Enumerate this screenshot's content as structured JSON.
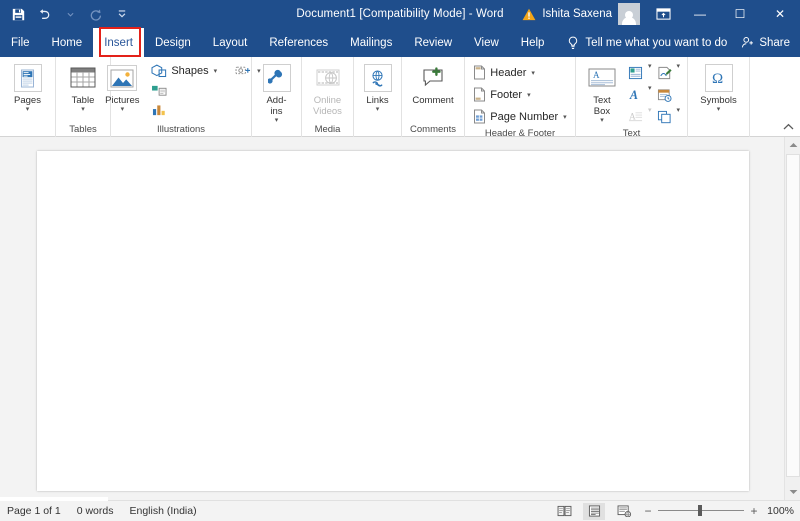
{
  "window": {
    "title": "Document1 [Compatibility Mode]  -  Word",
    "quick_access": [
      {
        "name": "save",
        "icon": "save-icon"
      },
      {
        "name": "undo",
        "icon": "undo-icon"
      },
      {
        "name": "redo",
        "icon": "redo-icon"
      },
      {
        "name": "customize-quick-access-toolbar",
        "icon": "chevron-down-icon"
      }
    ],
    "account_name": "Ishita Saxena",
    "warning_icon": "warning-triangle-icon",
    "ribbon_display_options_icon": "ribbon-display-options-icon",
    "minimize_label": "—",
    "maximize_label": "☐",
    "close_label": "✕"
  },
  "tabs": [
    {
      "label": "File",
      "active": false
    },
    {
      "label": "Home",
      "active": false
    },
    {
      "label": "Insert",
      "active": true
    },
    {
      "label": "Design",
      "active": false
    },
    {
      "label": "Layout",
      "active": false
    },
    {
      "label": "References",
      "active": false
    },
    {
      "label": "Mailings",
      "active": false
    },
    {
      "label": "Review",
      "active": false
    },
    {
      "label": "View",
      "active": false
    },
    {
      "label": "Help",
      "active": false
    }
  ],
  "tell_me": {
    "label": "Tell me what you want to do",
    "icon": "lightbulb-icon"
  },
  "share": {
    "label": "Share",
    "icon": "share-person-icon"
  },
  "highlight": {
    "target": "Insert",
    "color": "#e32119"
  },
  "ribbon": {
    "collapse_icon": "chevron-up-icon",
    "groups": [
      {
        "name": "pages",
        "label": "",
        "items": [
          {
            "name": "pages-button",
            "label": "Pages",
            "icon": "pages-icon",
            "type": "big",
            "caret": true,
            "disabled": false
          }
        ]
      },
      {
        "name": "tables",
        "label": "Tables",
        "items": [
          {
            "name": "table-button",
            "label": "Table",
            "icon": "table-icon",
            "type": "big",
            "caret": true,
            "disabled": false
          }
        ]
      },
      {
        "name": "illustrations",
        "label": "Illustrations",
        "items": [
          {
            "name": "pictures-button",
            "label": "Pictures",
            "icon": "pictures-icon",
            "type": "big",
            "caret": true,
            "disabled": false
          },
          {
            "name": "shapes-button",
            "label": "Shapes",
            "icon": "shapes-icon",
            "type": "small",
            "caret": true,
            "disabled": false
          },
          {
            "name": "smartart-button",
            "label": "",
            "icon": "smartart-icon",
            "type": "small",
            "caret": false,
            "disabled": false
          },
          {
            "name": "chart-button",
            "label": "",
            "icon": "chart-icon",
            "type": "small",
            "caret": false,
            "disabled": false
          },
          {
            "name": "screenshot-button",
            "label": "",
            "icon": "screenshot-icon",
            "type": "small",
            "caret": true,
            "disabled": false
          }
        ]
      },
      {
        "name": "add-ins",
        "label": "",
        "items": [
          {
            "name": "add-ins-button",
            "label": "Add-\nins",
            "icon": "add-ins-icon",
            "type": "big",
            "caret": true,
            "disabled": false
          }
        ]
      },
      {
        "name": "media",
        "label": "Media",
        "items": [
          {
            "name": "online-videos-button",
            "label": "Online\nVideos",
            "icon": "online-videos-icon",
            "type": "big",
            "caret": false,
            "disabled": true
          }
        ]
      },
      {
        "name": "links",
        "label": "",
        "items": [
          {
            "name": "links-button",
            "label": "Links",
            "icon": "links-icon",
            "type": "big",
            "caret": true,
            "disabled": false
          }
        ]
      },
      {
        "name": "comments",
        "label": "Comments",
        "items": [
          {
            "name": "comment-button",
            "label": "Comment",
            "icon": "comment-icon",
            "type": "big",
            "caret": false,
            "disabled": false
          }
        ]
      },
      {
        "name": "header-footer",
        "label": "Header & Footer",
        "items": [
          {
            "name": "header-button",
            "label": "Header",
            "icon": "header-icon",
            "type": "small",
            "caret": true,
            "disabled": false
          },
          {
            "name": "footer-button",
            "label": "Footer",
            "icon": "footer-icon",
            "type": "small",
            "caret": true,
            "disabled": false
          },
          {
            "name": "page-number-button",
            "label": "Page Number",
            "icon": "page-number-icon",
            "type": "small",
            "caret": true,
            "disabled": false
          }
        ]
      },
      {
        "name": "text",
        "label": "Text",
        "items": [
          {
            "name": "text-box-button",
            "label": "Text\nBox",
            "icon": "text-box-icon",
            "type": "big",
            "caret": true,
            "disabled": false
          },
          {
            "name": "quick-parts-button",
            "label": "",
            "icon": "quick-parts-icon",
            "type": "cell",
            "caret": true,
            "disabled": false
          },
          {
            "name": "signature-line-button",
            "label": "",
            "icon": "signature-line-icon",
            "type": "cell",
            "caret": true,
            "disabled": false
          },
          {
            "name": "wordart-button",
            "label": "",
            "icon": "wordart-icon",
            "type": "cell",
            "caret": true,
            "disabled": false
          },
          {
            "name": "date-time-button",
            "label": "",
            "icon": "date-time-icon",
            "type": "cell",
            "caret": false,
            "disabled": false
          },
          {
            "name": "drop-cap-button",
            "label": "",
            "icon": "drop-cap-icon",
            "type": "cell",
            "caret": true,
            "disabled": true
          },
          {
            "name": "object-button",
            "label": "",
            "icon": "object-icon",
            "type": "cell",
            "caret": true,
            "disabled": false
          }
        ]
      },
      {
        "name": "symbols",
        "label": "",
        "items": [
          {
            "name": "symbols-button",
            "label": "Symbols",
            "icon": "omega-icon",
            "type": "big",
            "caret": true,
            "disabled": false
          }
        ]
      }
    ]
  },
  "document": {
    "page_background": "#ffffff",
    "canvas_background": "#f3f3f3"
  },
  "scrollbar": {
    "up_arrow_icon": "scroll-up-arrow-icon",
    "down_arrow_icon": "scroll-down-arrow-icon"
  },
  "status_bar": {
    "page_info": "Page 1 of 1",
    "word_count": "0 words",
    "language": "English (India)",
    "views": [
      {
        "name": "read-mode-view-button",
        "icon": "read-mode-icon",
        "active": false
      },
      {
        "name": "print-layout-view-button",
        "icon": "print-layout-icon",
        "active": true
      },
      {
        "name": "web-layout-view-button",
        "icon": "web-layout-icon",
        "active": false
      }
    ],
    "zoom_out_label": "−",
    "zoom_in_label": "+",
    "zoom_level": "100%"
  }
}
